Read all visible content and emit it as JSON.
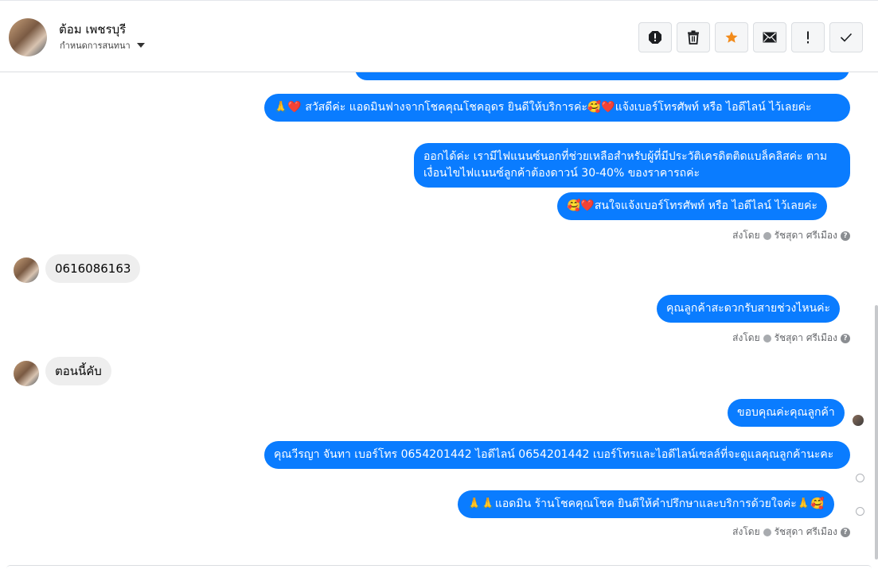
{
  "header": {
    "contact_name": "ต้อม เพชรบุรี",
    "assign_label": "กำหนดการสนทนา",
    "toolbar": [
      {
        "name": "report-spam-icon"
      },
      {
        "name": "trash-icon"
      },
      {
        "name": "star-icon"
      },
      {
        "name": "mail-icon"
      },
      {
        "name": "important-icon"
      },
      {
        "name": "checkmark-icon"
      }
    ]
  },
  "messages": [
    {
      "text": "🙏❤️ สวัสดีค่ะ แอดมินฟางจากโชคคุณโชคอุดร ยินดีให้บริการค่ะ🥰❤️แจ้งเบอร์โทรศัพท์ หรือ ไอดีไลน์  ไว้เลยค่ะ"
    },
    {
      "text": "ออกได้ค่ะ เรามีไฟแนนซ์นอกที่ช่วยเหลือสำหรับผู้ที่มีประวัติเครดิตติดแบล็คลิสค่ะ ตามเงื่อนไขไฟแนนซ์ลูกค้าต้องดาวน์ 30-40% ของราคารถค่ะ"
    },
    {
      "text": "🥰❤️สนใจแจ้งเบอร์โทรศัพท์ หรือ ไอดีไลน์  ไว้เลยค่ะ"
    },
    {
      "text": "0616086163"
    },
    {
      "text": "คุณลูกค้าสะดวกรับสายช่วงไหนค่ะ"
    },
    {
      "text": "ตอนนี้คับ"
    },
    {
      "text": "ขอบคุณค่ะคุณลูกค้า"
    },
    {
      "text": "คุณวีรญา จันทา      เบอร์โทร 0654201442  ไอดีไลน์ 0654201442     เบอร์โทรและไอดีไลน์เซลล์ที่จะดูแลคุณลูกค้านะคะ"
    },
    {
      "text": "🙏🙏แอดมิน ร้านโชคคุณโชค ยินดีให้คำปรึกษาและบริการด้วยใจค่ะ🙏🥰"
    }
  ],
  "sent_by": {
    "prefix": "ส่งโดย",
    "agent": "รัชสุดา ศรีเมือง",
    "help": "?"
  }
}
